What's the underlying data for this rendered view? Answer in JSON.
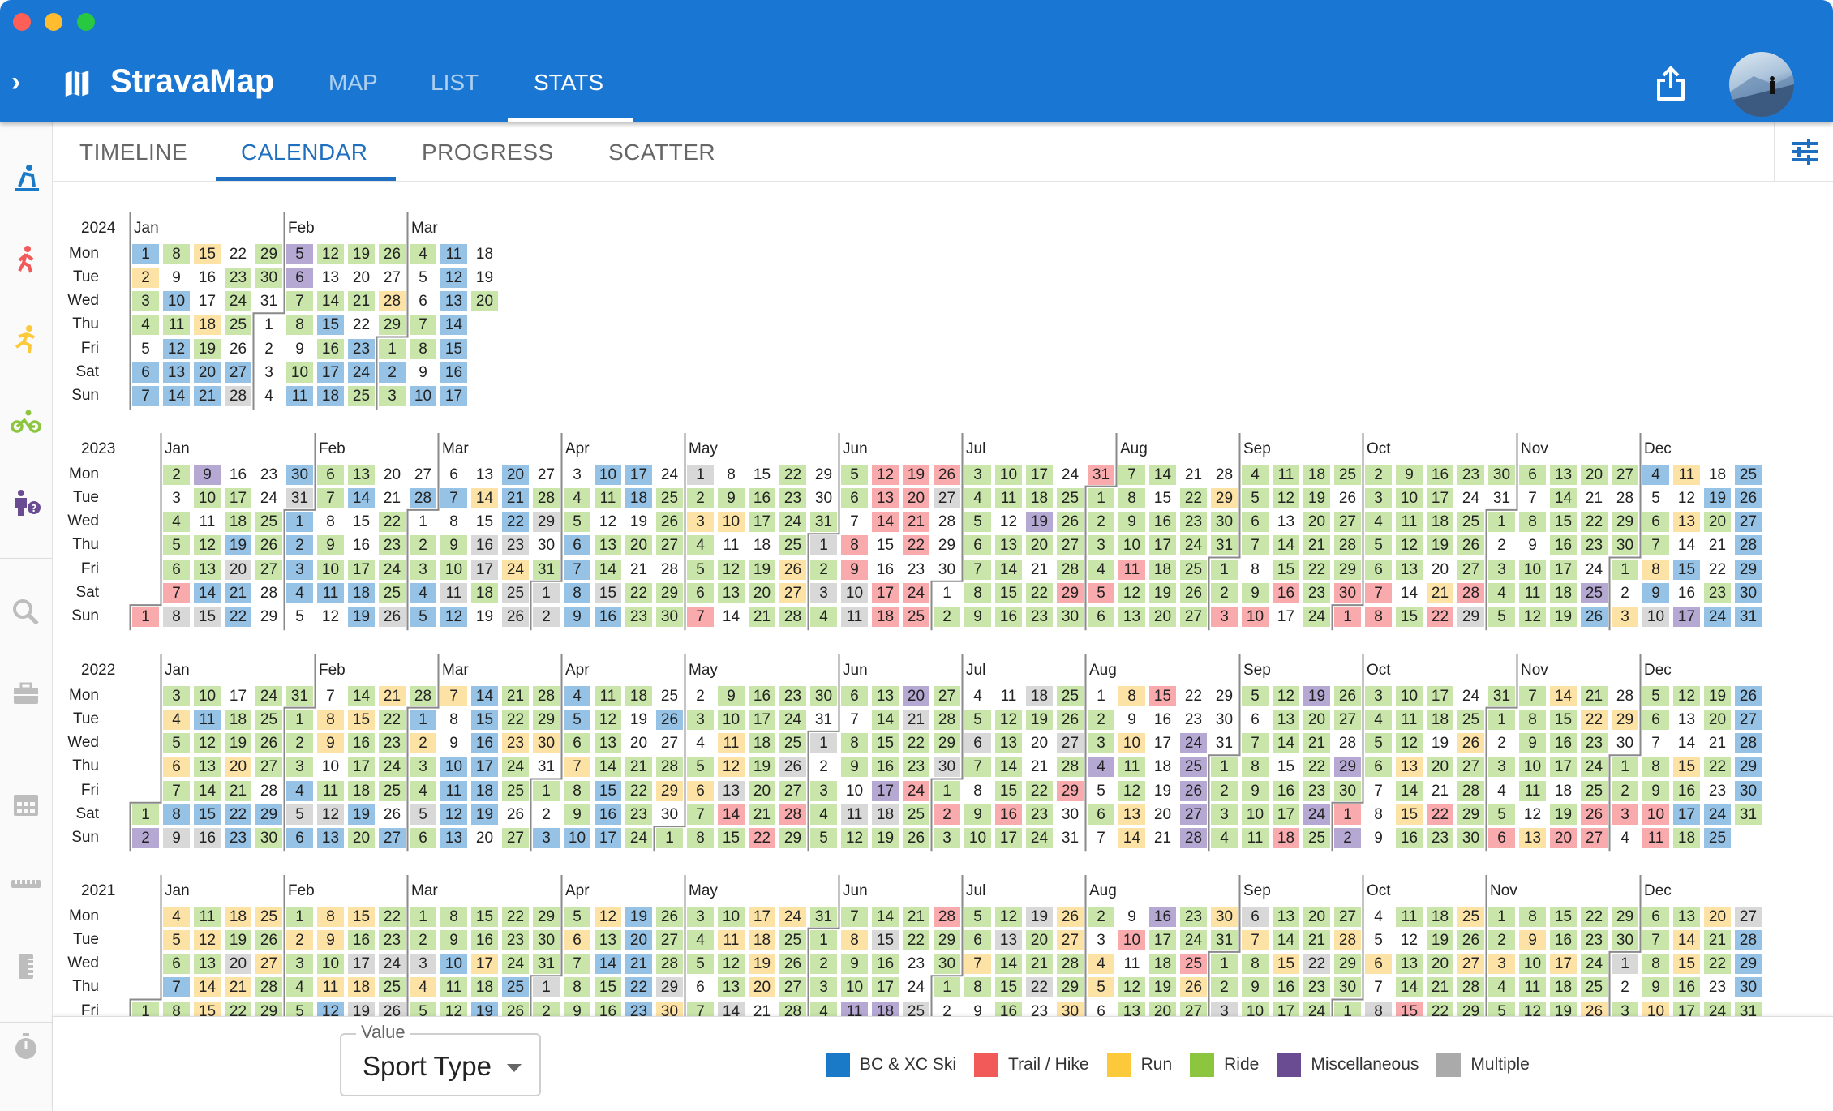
{
  "window": {
    "controls": [
      "close",
      "minimize",
      "zoom"
    ],
    "control_colors": [
      "#ff5f57",
      "#febc2e",
      "#28c840"
    ]
  },
  "app_bar": {
    "title": "StravaMap",
    "background": "#1976d2",
    "nav": [
      {
        "label": "MAP",
        "active": false
      },
      {
        "label": "LIST",
        "active": false
      },
      {
        "label": "STATS",
        "active": true
      }
    ],
    "icons": [
      "chevron-right-icon",
      "map-icon",
      "share-icon",
      "avatar"
    ]
  },
  "sub_tabs": [
    {
      "label": "TIMELINE",
      "active": false
    },
    {
      "label": "CALENDAR",
      "active": true
    },
    {
      "label": "PROGRESS",
      "active": false
    },
    {
      "label": "SCATTER",
      "active": false
    }
  ],
  "sidebar": {
    "sport_icons": [
      {
        "name": "ski-icon",
        "color": "#1a7ac7"
      },
      {
        "name": "hike-icon",
        "color": "#f25a5a"
      },
      {
        "name": "run-icon",
        "color": "#fcc93a"
      },
      {
        "name": "ride-icon",
        "color": "#8cc63f"
      },
      {
        "name": "misc-icon",
        "color": "#6a4c93"
      }
    ],
    "tool_icons": [
      "search-icon",
      "toolbox-icon",
      "calendar-icon",
      "ruler-icon",
      "notebook-icon",
      "stopwatch-icon"
    ]
  },
  "calendar": {
    "weekdays": [
      "Mon",
      "Tue",
      "Wed",
      "Thu",
      "Fri",
      "Sat",
      "Sun"
    ],
    "months": [
      "Jan",
      "Feb",
      "Mar",
      "Apr",
      "May",
      "Jun",
      "Jul",
      "Aug",
      "Sep",
      "Oct",
      "Nov",
      "Dec"
    ],
    "cell_colors": {
      "B": "#96c2e6",
      "T": "#f9aaad",
      "R": "#fde2a6",
      "G": "#c9e5aa",
      "M": "#b5a8d3",
      "X": "#d8d8d8"
    },
    "years": [
      {
        "year": "2024",
        "last_day": "03-20",
        "days": [
          "BRGG.BB",
          "G.BGBBB",
          "R..RGBB",
          ".GGG.BX",
          "GG.....",
          "MMGG.GB",
          "G.GBGBB",
          "G.G.BBG",
          "G.RGGBG",
          "G..GG.B",
          "BBBBBBB",
          "..G"
        ]
      },
      {
        "year": "2023",
        "last_day": "12-31",
        "days": [
          "T",
          "G.GGGTX",
          "MG.GGBX",
          ".GGBXBB",
          "..GGG..",
          "BXBBBB.",
          "GG.GGB.",
          "GB..GBB",
          "..GGGGX",
          ".B.GGBB",
          ".B.GGXB",
          ".R.XXG.",
          "BBBXRXX",
          ".GX.GXX",
          ".GGBBBB",
          "BG.GGXB",
          "BB.G.GG",
          ".GGG.GG",
          "XGRGGGT",
          ".GR.GG.",
          ".GG.GGG",
          "GGGGRRG",
          "..GXGXG",
          "GG.TTXX",
          "TTT..TT",
          "TTTT.TT",
          "TX....G",
          "GGGGGGG",
          "GG.GGGG",
          "GGMG.GG",
          ".GGGGTG",
          "TGGGGTG",
          "GGGGTGG",
          "G.GGGGG",
          ".GGGGGG",
          ".RGGGGT",
          "GGGG.GT",
          "GG.GGT.",
          "GGGGGGG",
          "G.GGGTT",
          "GGGGGTT",
          "GGGGG.G",
          "GGGG.RT",
          "G.GGGTX",
          "G.G.GGG",
          "G.G.GGG",
          "GGGGGGG",
          "G.GG.MB",
          "G.GGG.R",
          "B.GGRBX",
          "R.R.B.M",
          ".BG..GB",
          "BBBBBBB"
        ]
      },
      {
        "year": "2022",
        "last_day": "12-31",
        "days": [
          "GM",
          "GRGRGBX",
          "GBGGGBX",
          ".GGRGBB",
          "GGGG.BG",
          "GGGGBXB",
          ".RR.GXB",
          "GRGGGBG",
          "RGGGG.B",
          "GBRGGXG",
          "R..BBBB",
          "BBBBBB.",
          "GGRGG.G",
          "GGR.G.B",
          "BBGRGGB",
          "GGGGBBB",
          "G..GGGG",
          ".B.GR.G",
          ".G.GRGG",
          "GGRRXTG",
          "GGGGGGT",
          "GGGXGTG",
          "G.X.GGG",
          "G.GG.XG",
          "GGGGMXG",
          "MXGGTGG",
          "GGGXGTG",
          ".GXG.GG",
          ".GGGGTG",
          "XG..GGG",
          "GGXGT..",
          ".GGM.G.",
          "R.RGGRR",
          "T......",
          "..MMMMM",
          "...GGGG",
          "G.GGGGG",
          "GGG.GGT",
          "MGGGGMG",
          "GG.MGTM",
          "GGGG...",
          "GGGRGRG",
          "GG.G.TG",
          ".GRGGGG",
          "GG.G.GT",
          "GGGGG.R",
          "RGGG.GT",
          "GRGGGTT",
          ".R.GGT.",
          "GG.GGTT",
          "G..RGBG",
          "GG.G.BB",
          "BBBBBG"
        ]
      },
      {
        "year": "2021",
        "last_day": "12-31",
        "days": [
          "G..",
          "RRGBG..",
          "GRGRR..",
          "RGXRG..",
          "RGRGG..",
          "GRGGG..",
          "RRGRB..",
          "RGXRX..",
          "GGXGX..",
          "GGXRG..",
          "GGBGG..",
          "GGRGB..",
          "GGGBG..",
          "GGGXG..",
          "GRGGG..",
          "RGBGG..",
          "BBBBB..",
          "GGGXR..",
          "GGG.G..",
          "GRGGX..",
          "RRRR...",
          "RGGGG..",
          "GGGGG..",
          "GRGGM..",
          "GXGGM..",
          "GG..X..",
          "TGGG...",
          "GGRG...",
          "GXGGG..",
          "XGGX...",
          "RRGGR..",
          "G.RR...",
          ".T.GG..",
          "MGGGG..",
          "GGTRG..",
          "RGGGX..",
          "XRGGG..",
          "GGRGG..",
          "GGXGG..",
          "GRGGG..",
          "..R.X..",
          "G.GGT..",
          "GGGGG..",
          "RGRGG..",
          "GGRGG..",
          "GRGGG..",
          "GGRGG..",
          "GGGGR..",
          "GGX.G..",
          "GGGGR..",
          "GRRGG..",
          "RGG.G..",
          "XBBBG"
        ]
      }
    ]
  },
  "value_select": {
    "label": "Value",
    "selected": "Sport Type"
  },
  "legend": [
    {
      "code": "B",
      "label": "BC & XC Ski",
      "color": "#1a7ac7"
    },
    {
      "code": "T",
      "label": "Trail / Hike",
      "color": "#f25a5a"
    },
    {
      "code": "R",
      "label": "Run",
      "color": "#fcc93a"
    },
    {
      "code": "G",
      "label": "Ride",
      "color": "#8cc63f"
    },
    {
      "code": "M",
      "label": "Miscellaneous",
      "color": "#6a4c93"
    },
    {
      "code": "X",
      "label": "Multiple",
      "color": "#aaaaaa"
    }
  ]
}
